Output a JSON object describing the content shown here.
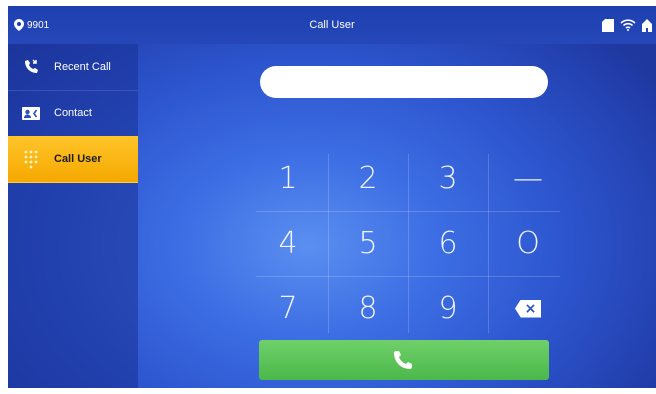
{
  "topbar": {
    "location": "9901",
    "title": "Call User",
    "icons": [
      "location-pin-icon",
      "sd-card-icon",
      "wifi-icon",
      "home-icon"
    ]
  },
  "sidebar": {
    "items": [
      {
        "label": "Recent Call",
        "icon": "recent-call-icon",
        "active": false
      },
      {
        "label": "Contact",
        "icon": "contact-card-icon",
        "active": false
      },
      {
        "label": "Call User",
        "icon": "keypad-icon",
        "active": true
      }
    ]
  },
  "dial": {
    "number_value": "",
    "keys": [
      "1",
      "2",
      "3",
      "—",
      "4",
      "5",
      "6",
      "O",
      "7",
      "8",
      "9"
    ]
  },
  "colors": {
    "accent_active": "#f5a800",
    "call_button": "#4bb84a",
    "topbar": "#1e3fb0"
  }
}
